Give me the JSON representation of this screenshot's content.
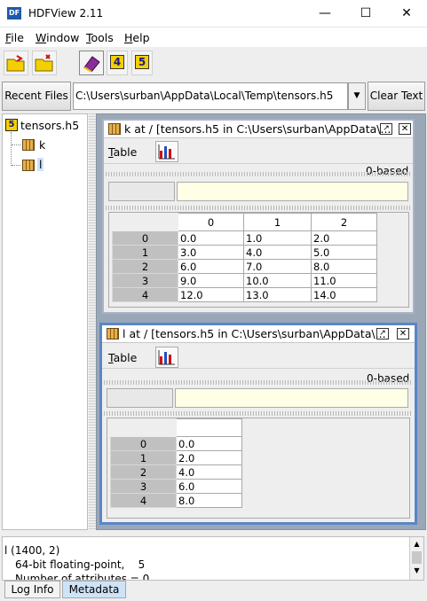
{
  "app": {
    "title": "HDFView 2.11",
    "icon_label": "DF"
  },
  "window_controls": {
    "minimize": "—",
    "maximize": "☐",
    "close": "✕"
  },
  "menu": [
    {
      "label": "File",
      "mnemonic": "F",
      "rest": "ile"
    },
    {
      "label": "Window",
      "mnemonic": "W",
      "rest": "indow"
    },
    {
      "label": "Tools",
      "mnemonic": "T",
      "rest": "ools"
    },
    {
      "label": "Help",
      "mnemonic": "H",
      "rest": "elp"
    }
  ],
  "toolbar": {
    "open_icon": "open-folder-icon",
    "new_icon": "new-folder-icon",
    "help_icon": "book-icon",
    "hdf4_label": "4",
    "hdf5_label": "5"
  },
  "urlbar": {
    "recent_label": "Recent Files",
    "path": "C:\\Users\\surban\\AppData\\Local\\Temp\\tensors.h5",
    "clear_label": "Clear Text"
  },
  "tree": {
    "root": "tensors.h5",
    "root_badge": "5",
    "items": [
      "k",
      "l"
    ]
  },
  "frames": [
    {
      "name": "k",
      "title": "k  at  /  [tensors.h5  in  C:\\Users\\surban\\AppData\\...",
      "menu_label": "Table",
      "menu_mnemonic": "T",
      "menu_rest": "able",
      "indexing": "0-based",
      "columns": [
        "0",
        "1",
        "2"
      ],
      "rows": [
        {
          "index": "0",
          "cells": [
            "0.0",
            "1.0",
            "2.0"
          ]
        },
        {
          "index": "1",
          "cells": [
            "3.0",
            "4.0",
            "5.0"
          ]
        },
        {
          "index": "2",
          "cells": [
            "6.0",
            "7.0",
            "8.0"
          ]
        },
        {
          "index": "3",
          "cells": [
            "9.0",
            "10.0",
            "11.0"
          ]
        },
        {
          "index": "4",
          "cells": [
            "12.0",
            "13.0",
            "14.0"
          ]
        }
      ]
    },
    {
      "name": "l",
      "title": "l  at  /  [tensors.h5  in  C:\\Users\\surban\\AppData\\...",
      "menu_label": "Table",
      "menu_mnemonic": "T",
      "menu_rest": "able",
      "indexing": "0-based",
      "rows": [
        {
          "index": "0",
          "value": "0.0"
        },
        {
          "index": "1",
          "value": "2.0"
        },
        {
          "index": "2",
          "value": "4.0"
        },
        {
          "index": "3",
          "value": "6.0"
        },
        {
          "index": "4",
          "value": "8.0"
        }
      ]
    }
  ],
  "status": {
    "line1": "l (1400, 2)",
    "line2": "64-bit floating-point,    5",
    "line3": "Number of attributes = 0"
  },
  "bottom_tabs": [
    "Log Info",
    "Metadata"
  ],
  "colors": {
    "accent": "#1e5aa8",
    "selected_tab": "#cfe3f7",
    "desktop": "#9aa7b6",
    "input_bg": "#ffffe6"
  }
}
